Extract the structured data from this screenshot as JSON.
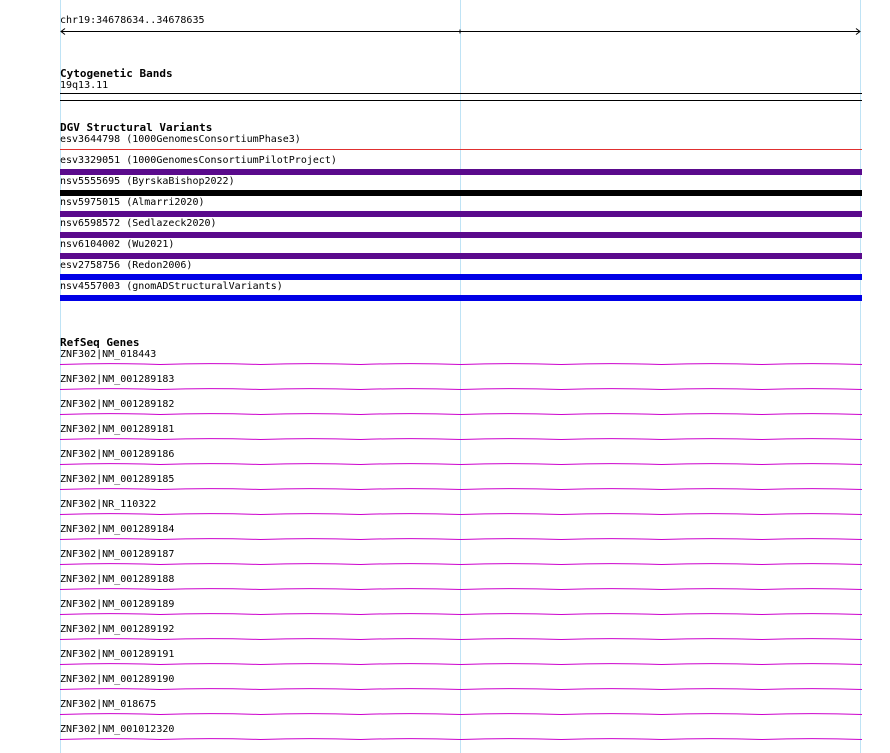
{
  "colors": {
    "grid": "#bfe3f5",
    "gene": "#cc00cc",
    "purple": "#5a0a8c",
    "black": "#000000",
    "blue": "#0000e6",
    "red": "#e03030"
  },
  "ruler": {
    "location": "chr19:34678634..34678635"
  },
  "cytoband": {
    "title": "Cytogenetic Bands",
    "band_label": "19q13.11"
  },
  "dgv": {
    "title": "DGV Structural Variants",
    "variants": [
      {
        "label": "esv3644798 (1000GenomesConsortiumPhase3)",
        "color": "#e03030",
        "bar": "thin"
      },
      {
        "label": "esv3329051 (1000GenomesConsortiumPilotProject)",
        "color": "#5a0a8c",
        "bar": "thick"
      },
      {
        "label": "nsv5555695 (ByrskaBishop2022)",
        "color": "#000000",
        "bar": "thick"
      },
      {
        "label": "nsv5975015 (Almarri2020)",
        "color": "#5a0a8c",
        "bar": "thick"
      },
      {
        "label": "nsv6598572 (Sedlazeck2020)",
        "color": "#5a0a8c",
        "bar": "thick"
      },
      {
        "label": "nsv6104002 (Wu2021)",
        "color": "#5a0a8c",
        "bar": "thick"
      },
      {
        "label": "esv2758756 (Redon2006)",
        "color": "#0000e6",
        "bar": "thick"
      },
      {
        "label": "nsv4557003 (gnomADStructuralVariants)",
        "color": "#0000e6",
        "bar": "thick"
      }
    ]
  },
  "refseq": {
    "title": "RefSeq Genes",
    "genes": [
      "ZNF302|NM_018443",
      "ZNF302|NM_001289183",
      "ZNF302|NM_001289182",
      "ZNF302|NM_001289181",
      "ZNF302|NM_001289186",
      "ZNF302|NM_001289185",
      "ZNF302|NR_110322",
      "ZNF302|NM_001289184",
      "ZNF302|NM_001289187",
      "ZNF302|NM_001289188",
      "ZNF302|NM_001289189",
      "ZNF302|NM_001289192",
      "ZNF302|NM_001289191",
      "ZNF302|NM_001289190",
      "ZNF302|NM_018675",
      "ZNF302|NM_001012320"
    ]
  }
}
